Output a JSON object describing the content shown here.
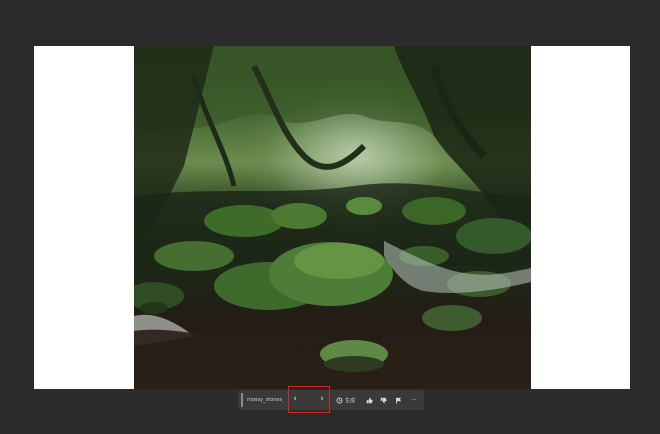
{
  "viewer": {
    "filename": "mossy_stones_b...",
    "ai_label": "生成",
    "prev_symbol": "‹",
    "next_symbol": "›",
    "more_symbol": "···"
  },
  "icons": {
    "prev": "chevron-left-icon",
    "next": "chevron-right-icon",
    "ai": "ai-spark-icon",
    "like": "thumbs-up-icon",
    "dislike": "thumbs-down-icon",
    "flag": "flag-icon",
    "more": "more-icon"
  },
  "colors": {
    "app_background": "#2b2b2b",
    "canvas": "#ffffff",
    "toolbar": "#3a3a3a",
    "highlight_box": "#d12a2a"
  }
}
